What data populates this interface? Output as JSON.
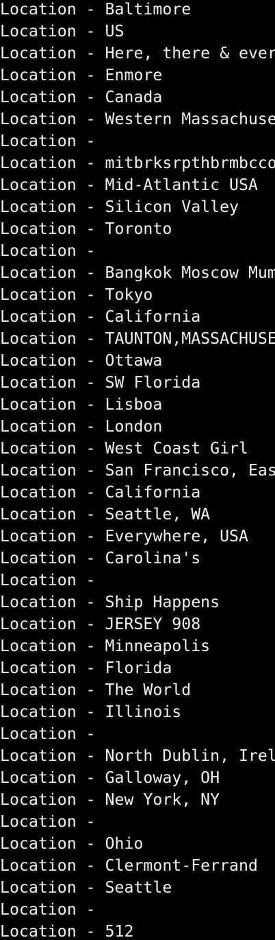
{
  "terminal": {
    "background": "#000000",
    "text_color": "#f2f2f2",
    "lines": [
      "Location - Baltimore",
      "Location - US",
      "Location - Here, there & ever",
      "Location - Enmore",
      "Location - Canada",
      "Location - Western Massachuse",
      "Location - ",
      "Location - mitbrksrpthbrmbcco",
      "Location - Mid-Atlantic USA",
      "Location - Silicon Valley",
      "Location - Toronto",
      "Location - ",
      "Location - Bangkok Moscow Mum",
      "Location - Tokyo",
      "Location - California",
      "Location - TAUNTON,MASSACHUSE",
      "Location - Ottawa",
      "Location - SW Florida",
      "Location - Lisboa",
      "Location - London",
      "Location - West Coast Girl",
      "Location - San Francisco, Eas",
      "Location - California",
      "Location - Seattle, WA",
      "Location - Everywhere, USA",
      "Location - Carolina's",
      "Location - ",
      "Location - Ship Happens",
      "Location - JERSEY 908",
      "Location - Minneapolis",
      "Location - Florida",
      "Location - The World",
      "Location - Illinois",
      "Location - ",
      "Location - North Dublin, Irel",
      "Location - Galloway, OH",
      "Location - New York, NY",
      "Location - ",
      "Location - Ohio",
      "Location - Clermont-Ferrand",
      "Location - Seattle",
      "Location - ",
      "Location - 512"
    ]
  }
}
